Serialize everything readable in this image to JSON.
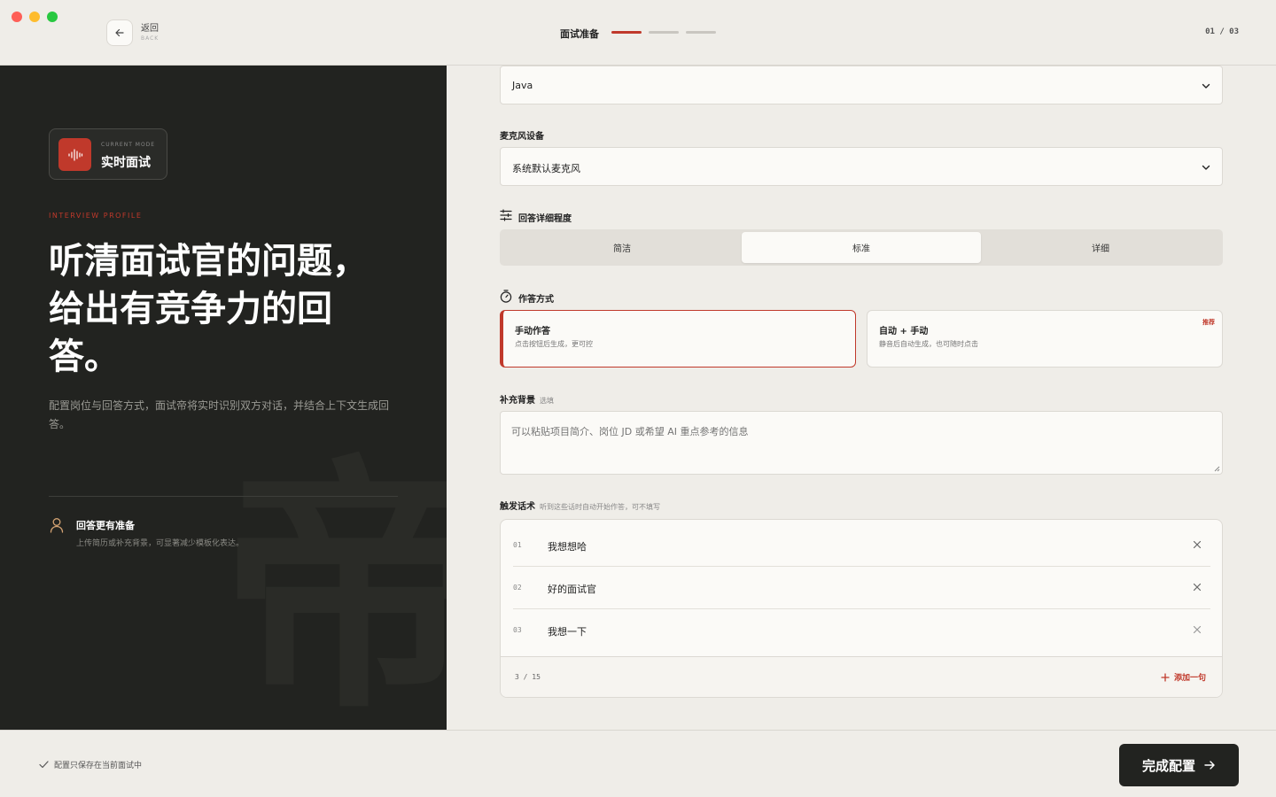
{
  "header": {
    "back_label": "返回",
    "back_sub": "BACK",
    "step_title": "面试准备",
    "step_counter": "01 / 03",
    "step_progress": {
      "current": 1,
      "total": 3
    }
  },
  "left": {
    "mode_label": "CURRENT MODE",
    "mode_name": "实时面试",
    "profile_label": "INTERVIEW PROFILE",
    "headline": "听清面试官的问题，给出有竞争力的回答。",
    "description": "配置岗位与回答方式，面试帝将实时识别双方对话，并结合上下文生成回答。",
    "feature_title": "回答更有准备",
    "feature_desc": "上传简历或补充背景，可显著减少模板化表达。",
    "watermark": "帝"
  },
  "form": {
    "language_value": "Java",
    "mic_label": "麦克风设备",
    "mic_value": "系统默认麦克风",
    "detail_label": "回答详细程度",
    "detail_options": [
      "简洁",
      "标准",
      "详细"
    ],
    "detail_selected": "标准",
    "answer_label": "作答方式",
    "answer_modes": [
      {
        "title": "手动作答",
        "desc": "点击按钮后生成，更可控",
        "selected": true,
        "badge": ""
      },
      {
        "title": "自动 + 手动",
        "desc": "静音后自动生成，也可随时点击",
        "selected": false,
        "badge": "推荐"
      }
    ],
    "background_label": "补充背景",
    "background_hint": "选填",
    "background_placeholder": "可以粘贴项目简介、岗位 JD 或希望 AI 重点参考的信息",
    "trigger_label": "触发话术",
    "trigger_hint": "听到这些话时自动开始作答，可不填写",
    "triggers": [
      {
        "num": "01",
        "text": "我想想哈"
      },
      {
        "num": "02",
        "text": "好的面试官"
      },
      {
        "num": "03",
        "text": "我想一下"
      }
    ],
    "trigger_count": "3 / 15",
    "add_label": "添加一句"
  },
  "footer": {
    "save_note": "配置只保存在当前面试中",
    "finish_label": "完成配置"
  },
  "colors": {
    "accent": "#c0392b",
    "dark": "#222320",
    "background": "#efede8"
  }
}
